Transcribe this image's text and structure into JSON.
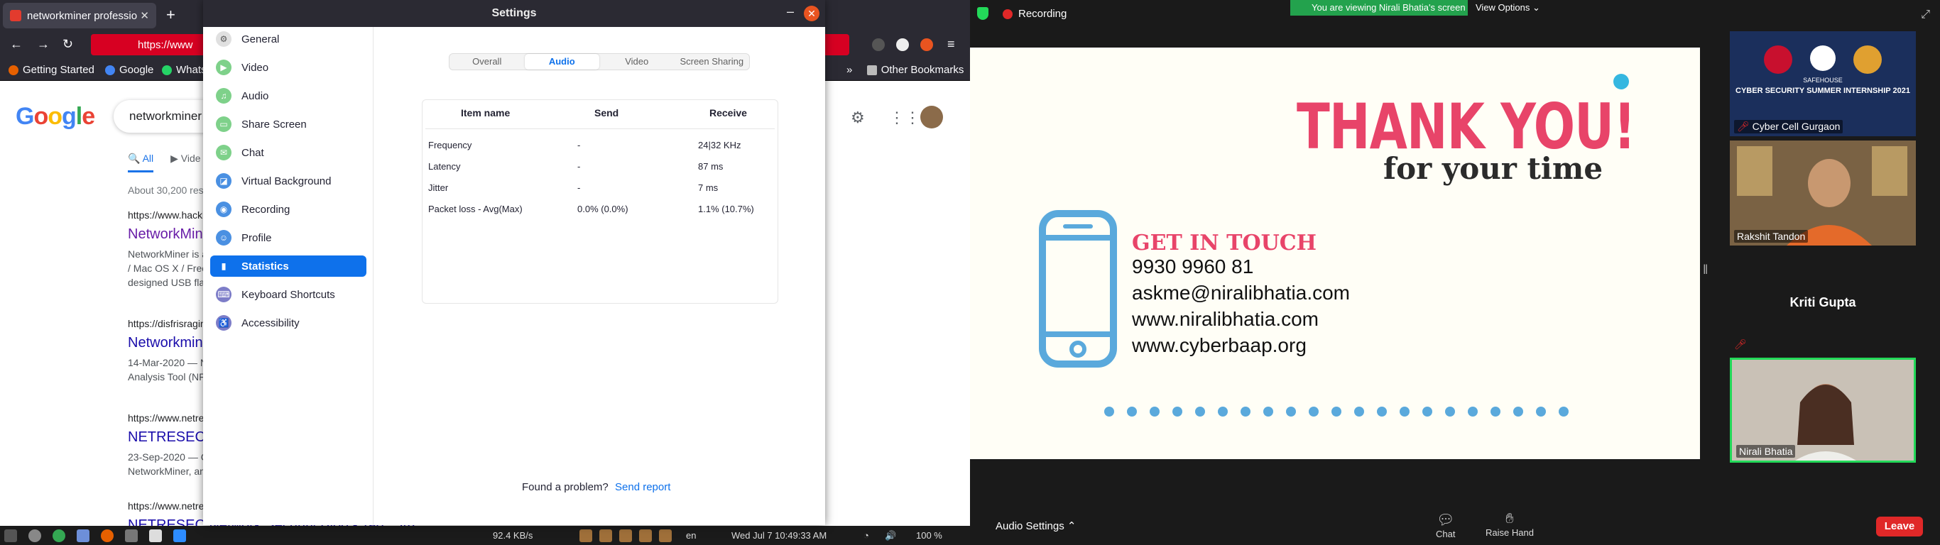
{
  "browser": {
    "tab_title": "networkminer professio",
    "url": "https://www",
    "bookmarks": [
      "Getting Started",
      "Google",
      "Whats",
      "Other Bookmarks"
    ],
    "search_query": "networkminer p",
    "tabs": [
      "All",
      "Vide"
    ],
    "result_count": "About 30,200 res",
    "results": [
      {
        "url": "https://www.hacki",
        "title": "NetworkMin",
        "snippet1": "NetworkMiner is a",
        "snippet2": "/ Mac OS X / Free",
        "snippet3": "designed USB fla"
      },
      {
        "url": "https://disfrisragin",
        "title": "Networkmin",
        "snippet1": "14-Mar-2020 — N",
        "snippet2": "Analysis Tool (NF"
      },
      {
        "url": "https://www.netres",
        "title": "NETRESEC",
        "snippet1": "23-Sep-2020 — C",
        "snippet2": "NetworkMiner, an"
      },
      {
        "url": "https://www.netres",
        "title": "NETRESEC Network Security Blog - Tag : JtR"
      }
    ],
    "logo": "Google"
  },
  "taskbar": {
    "net_speed": "92.4 KB/s",
    "lang": "en",
    "datetime": "Wed Jul 7  10:49:33 AM",
    "battery": "100 %"
  },
  "settings": {
    "title": "Settings",
    "sidebar": [
      {
        "label": "General",
        "icon": "gear-icon",
        "color": "#e6e6e6"
      },
      {
        "label": "Video",
        "icon": "video-icon",
        "color": "#7ed18a"
      },
      {
        "label": "Audio",
        "icon": "headphone-icon",
        "color": "#7ed18a"
      },
      {
        "label": "Share Screen",
        "icon": "share-screen-icon",
        "color": "#7ed18a"
      },
      {
        "label": "Chat",
        "icon": "chat-icon",
        "color": "#7ed18a"
      },
      {
        "label": "Virtual Background",
        "icon": "virtual-bg-icon",
        "color": "#4a90e2"
      },
      {
        "label": "Recording",
        "icon": "recording-icon",
        "color": "#4a90e2"
      },
      {
        "label": "Profile",
        "icon": "profile-icon",
        "color": "#4a90e2"
      },
      {
        "label": "Statistics",
        "icon": "statistics-icon",
        "color": "#0e71eb"
      },
      {
        "label": "Keyboard Shortcuts",
        "icon": "keyboard-icon",
        "color": "#7d7dc8"
      },
      {
        "label": "Accessibility",
        "icon": "accessibility-icon",
        "color": "#7d7dc8"
      }
    ],
    "segments": [
      "Overall",
      "Audio",
      "Video",
      "Screen Sharing"
    ],
    "selected_segment": "Audio",
    "table": {
      "headers": [
        "Item name",
        "Send",
        "Receive"
      ],
      "rows": [
        {
          "item": "Frequency",
          "send": "-",
          "receive": "24|32 KHz"
        },
        {
          "item": "Latency",
          "send": "-",
          "receive": "87 ms"
        },
        {
          "item": "Jitter",
          "send": "-",
          "receive": "7 ms"
        },
        {
          "item": "Packet loss - Avg(Max)",
          "send": "0.0%  (0.0%)",
          "receive": "1.1%  (10.7%)"
        }
      ]
    },
    "footer_text": "Found a problem?",
    "footer_link": "Send report"
  },
  "meeting": {
    "recording_label": "Recording",
    "viewing_banner": "You are viewing Nirali Bhatia's screen",
    "view_options": "View Options",
    "slide": {
      "headline": "THANK YOU!",
      "subline": "for your time",
      "contact_title": "GET IN TOUCH",
      "phone": "9930 9960 81",
      "email": "askme@niralibhatia.com",
      "website1": "www.niralibhatia.com",
      "website2": "www.cyberbaap.org",
      "dot_count": 21
    },
    "participants": [
      {
        "name": "Cyber Cell Gurgaon",
        "banner": "CYBER SECURITY SUMMER INTERNSHIP 2021",
        "logo_text": "SAFEHOUSE"
      },
      {
        "name": "Rakshit Tandon"
      },
      {
        "name": "Kriti Gupta"
      },
      {
        "name": "Nirali Bhatia"
      }
    ],
    "audio_settings": "Audio Settings",
    "chat_label": "Chat",
    "raise_hand_label": "Raise Hand",
    "leave_label": "Leave"
  },
  "colors": {
    "accent": "#0e71eb",
    "slide_pink": "#e84469",
    "slide_blue": "#5aa9dc",
    "zoom_green": "#23d959",
    "leave_red": "#e02828"
  }
}
